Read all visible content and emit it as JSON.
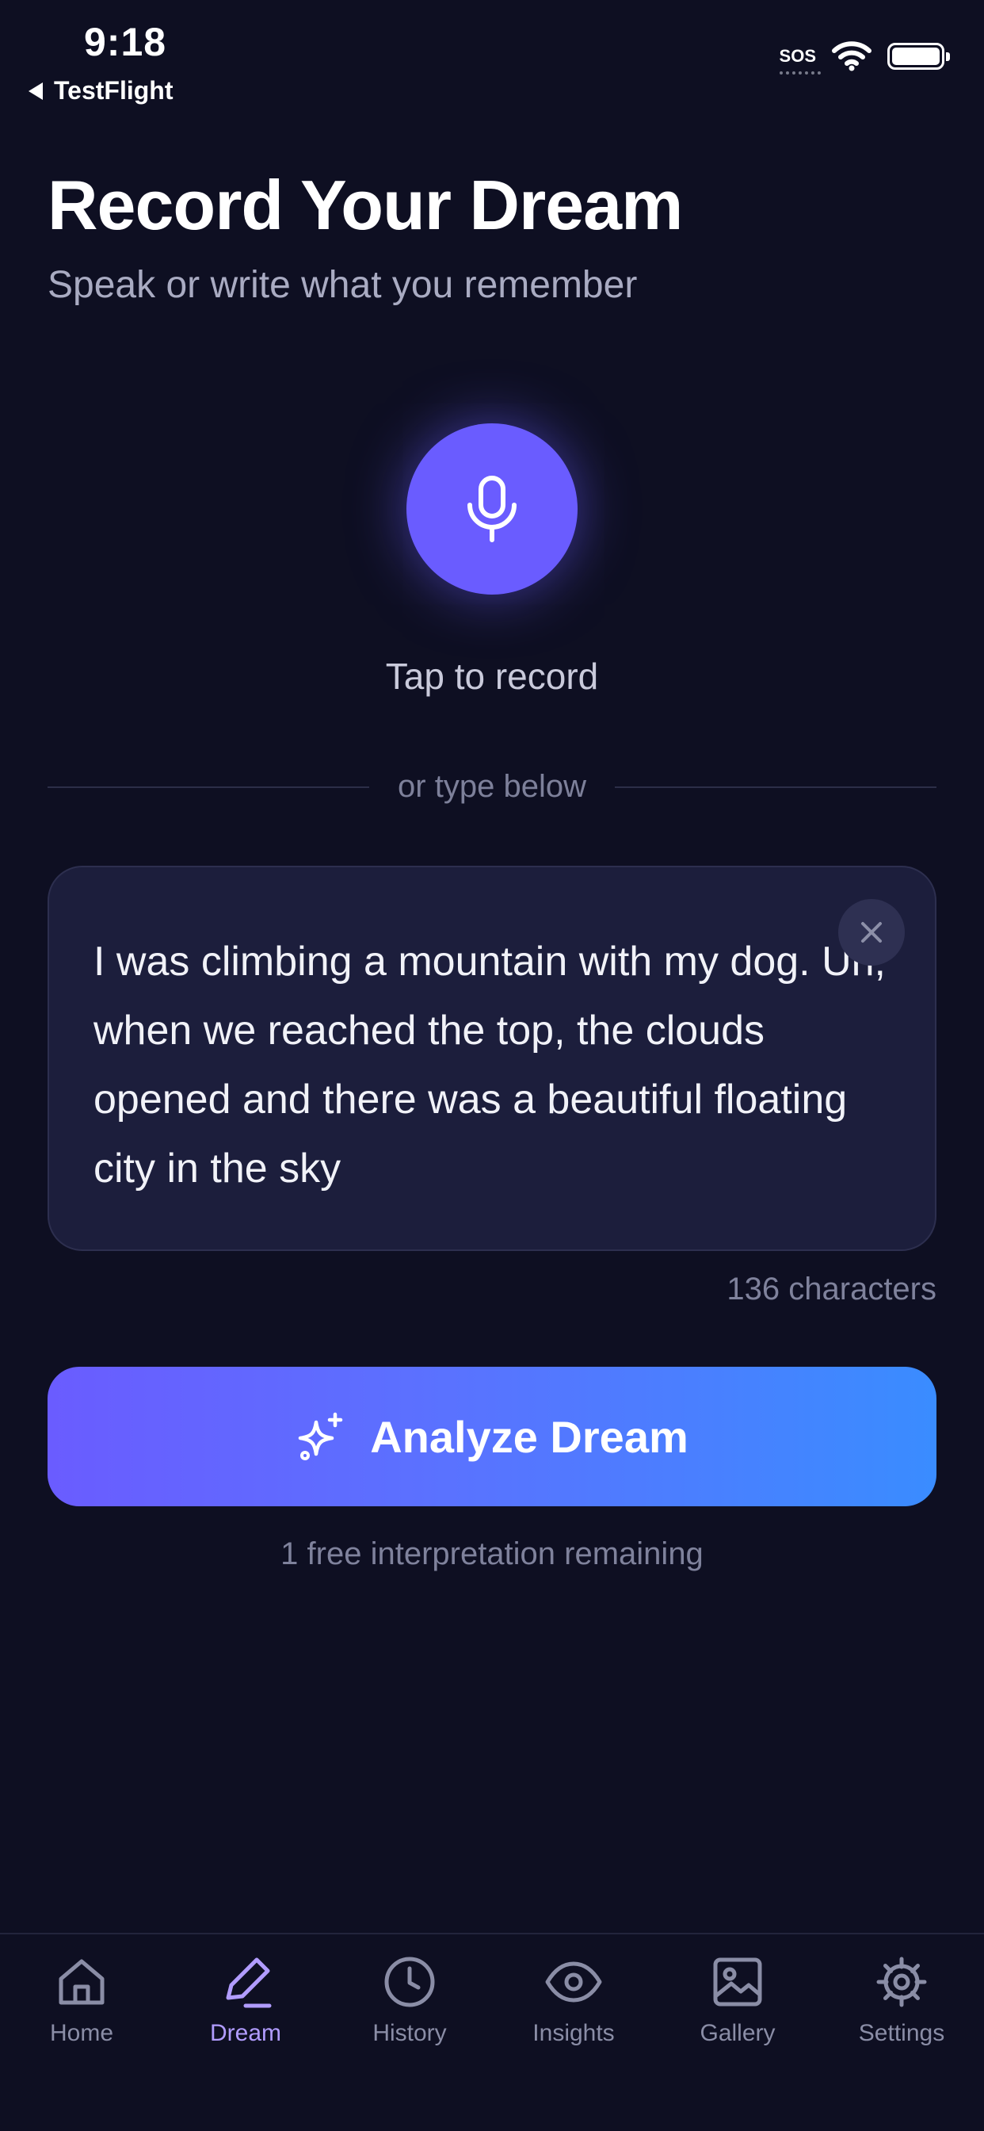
{
  "status_bar": {
    "time": "9:18",
    "back_label": "TestFlight",
    "sos": "SOS"
  },
  "header": {
    "title": "Record Your Dream",
    "subtitle": "Speak or write what you remember"
  },
  "record": {
    "icon": "microphone-icon",
    "tap_label": "Tap to record",
    "divider_text": "or type below"
  },
  "dream_input": {
    "value": "I was climbing a mountain with my dog. Uh, when we reached the top, the clouds opened and there was a beautiful floating city in the sky",
    "char_count": "136 characters"
  },
  "analyze": {
    "label": "Analyze Dream",
    "icon": "sparkles-icon",
    "remaining": "1 free interpretation remaining"
  },
  "tabs": [
    {
      "label": "Home",
      "icon": "home-icon",
      "active": false
    },
    {
      "label": "Dream",
      "icon": "pencil-icon",
      "active": true
    },
    {
      "label": "History",
      "icon": "clock-icon",
      "active": false
    },
    {
      "label": "Insights",
      "icon": "eye-icon",
      "active": false
    },
    {
      "label": "Gallery",
      "icon": "image-icon",
      "active": false
    },
    {
      "label": "Settings",
      "icon": "gear-icon",
      "active": false
    }
  ],
  "colors": {
    "background": "#0e0f22",
    "accent": "#6a5cff",
    "gradient_end": "#3a8cff",
    "active_tab": "#b19cff",
    "card": "#1c1e3c"
  }
}
